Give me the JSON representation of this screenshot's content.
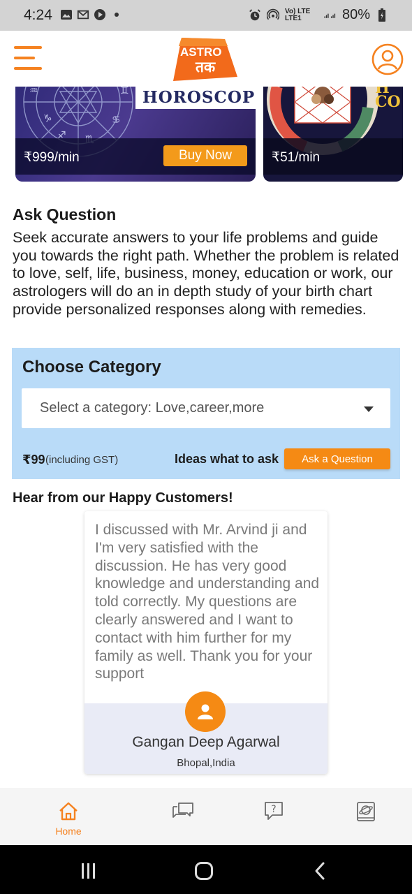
{
  "status_bar": {
    "time": "4:24",
    "network": "Vo) LTE LTE1",
    "battery": "80%"
  },
  "header": {
    "logo_top": "ASTRO",
    "logo_bottom": "तक"
  },
  "banners": [
    {
      "title": "HOROSCOPE",
      "price": "₹999/min",
      "button": "Buy Now"
    },
    {
      "title_partial": "H\nCO",
      "price": "₹51/min"
    }
  ],
  "ask_question": {
    "title": "Ask Question",
    "description": "Seek accurate answers to your life problems and guide you towards the right path. Whether the problem is related to love, self, life, business, money, education or work, our astrologers will do an in depth study of your birth chart provide personalized responses along with remedies."
  },
  "category": {
    "title": "Choose Category",
    "select_text": "Select a category: Love,career,more",
    "fee": "₹99",
    "fee_note": "(including GST)",
    "ideas_label": "Ideas what to ask",
    "ask_button": "Ask a Question"
  },
  "testimonials": {
    "heading": "Hear from our Happy Customers!",
    "items": [
      {
        "text": "I discussed with Mr. Arvind ji and I'm very satisfied with the discussion. He has very good knowledge and understanding and told correctly. My questions are clearly answered and I want to contact with him further for my family as well. Thank you for your support",
        "name": "Gangan Deep Agarwal",
        "location": "Bhopal,India"
      }
    ]
  },
  "bottom_nav": {
    "items": [
      {
        "label": "Home",
        "icon": "home-icon",
        "active": true
      },
      {
        "label": "",
        "icon": "chat-icon",
        "active": false
      },
      {
        "label": "",
        "icon": "question-icon",
        "active": false
      },
      {
        "label": "",
        "icon": "planet-book-icon",
        "active": false
      }
    ]
  },
  "colors": {
    "accent": "#f58220",
    "panel": "#b9dbf8",
    "banner_button": "#f39a1b"
  }
}
